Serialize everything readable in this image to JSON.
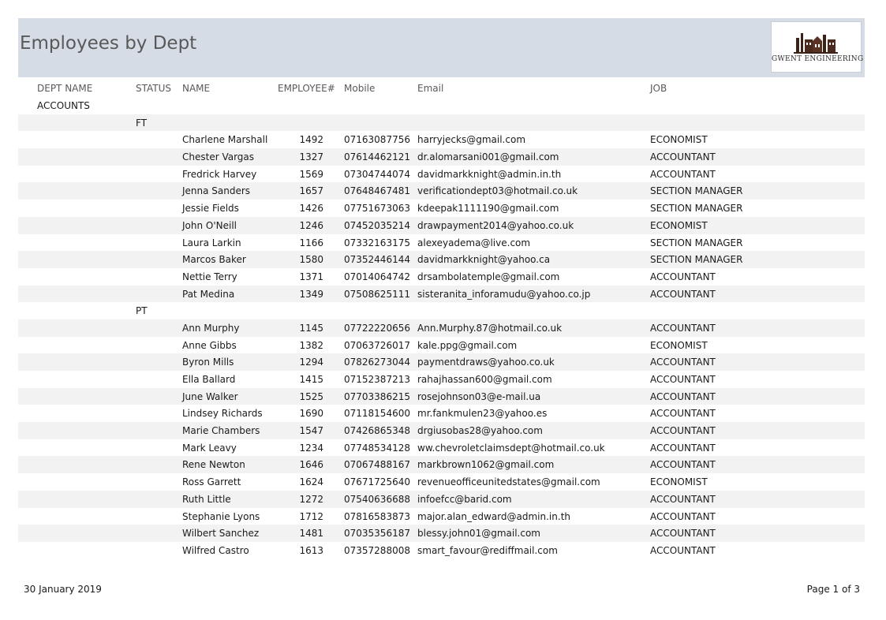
{
  "report": {
    "title": "Employees by Dept",
    "logo_text": "GWENT ENGINEERING"
  },
  "columns": {
    "dept_name": "DEPT NAME",
    "status": "STATUS",
    "name": "NAME",
    "employee_no": "EMPLOYEE#",
    "mobile": "Mobile",
    "email": "Email",
    "job": "JOB"
  },
  "department": "ACCOUNTS",
  "groups": [
    {
      "status": "FT",
      "employees": [
        {
          "name": "Charlene Marshall",
          "id": "1492",
          "mobile": "07163087756",
          "email": "harryjecks@gmail.com",
          "job": "ECONOMIST"
        },
        {
          "name": "Chester Vargas",
          "id": "1327",
          "mobile": "07614462121",
          "email": "dr.alomarsani001@gmail.com",
          "job": "ACCOUNTANT"
        },
        {
          "name": "Fredrick Harvey",
          "id": "1569",
          "mobile": "07304744074",
          "email": "davidmarkknight@admin.in.th",
          "job": "ACCOUNTANT"
        },
        {
          "name": "Jenna Sanders",
          "id": "1657",
          "mobile": "07648467481",
          "email": "verificationdept03@hotmail.co.uk",
          "job": "SECTION MANAGER"
        },
        {
          "name": "Jessie Fields",
          "id": "1426",
          "mobile": "07751673063",
          "email": "kdeepak1111190@gmail.com",
          "job": "SECTION MANAGER"
        },
        {
          "name": "John O'Neill",
          "id": "1246",
          "mobile": "07452035214",
          "email": "drawpayment2014@yahoo.co.uk",
          "job": "ECONOMIST"
        },
        {
          "name": "Laura Larkin",
          "id": "1166",
          "mobile": "07332163175",
          "email": "alexeyadema@live.com",
          "job": "SECTION MANAGER"
        },
        {
          "name": "Marcos Baker",
          "id": "1580",
          "mobile": "07352446144",
          "email": "davidmarkknight@yahoo.ca",
          "job": "SECTION MANAGER"
        },
        {
          "name": "Nettie Terry",
          "id": "1371",
          "mobile": "07014064742",
          "email": "drsambolatemple@gmail.com",
          "job": "ACCOUNTANT"
        },
        {
          "name": "Pat Medina",
          "id": "1349",
          "mobile": "07508625111",
          "email": "sisteranita_inforamudu@yahoo.co.jp",
          "job": "ACCOUNTANT"
        }
      ]
    },
    {
      "status": "PT",
      "employees": [
        {
          "name": "Ann Murphy",
          "id": "1145",
          "mobile": "07722220656",
          "email": "Ann.Murphy.87@hotmail.co.uk",
          "job": "ACCOUNTANT"
        },
        {
          "name": "Anne Gibbs",
          "id": "1382",
          "mobile": "07063726017",
          "email": "kale.ppg@gmail.com",
          "job": "ECONOMIST"
        },
        {
          "name": "Byron Mills",
          "id": "1294",
          "mobile": "07826273044",
          "email": "paymentdraws@yahoo.co.uk",
          "job": "ACCOUNTANT"
        },
        {
          "name": "Ella Ballard",
          "id": "1415",
          "mobile": "07152387213",
          "email": "rahajhassan600@gmail.com",
          "job": "ACCOUNTANT"
        },
        {
          "name": "June Walker",
          "id": "1525",
          "mobile": "07703386215",
          "email": "rosejohnson03@e-mail.ua",
          "job": "ACCOUNTANT"
        },
        {
          "name": "Lindsey Richards",
          "id": "1690",
          "mobile": "07118154600",
          "email": "mr.fankmulen23@yahoo.es",
          "job": "ACCOUNTANT"
        },
        {
          "name": "Marie Chambers",
          "id": "1547",
          "mobile": "07426865348",
          "email": "drgiusobas28@yahoo.com",
          "job": "ACCOUNTANT"
        },
        {
          "name": "Mark Leavy",
          "id": "1234",
          "mobile": "07748534128",
          "email": "ww.chevroletclaimsdept@hotmail.co.uk",
          "job": "ACCOUNTANT"
        },
        {
          "name": "Rene Newton",
          "id": "1646",
          "mobile": "07067488167",
          "email": "markbrown1062@gmail.com",
          "job": "ACCOUNTANT"
        },
        {
          "name": "Ross Garrett",
          "id": "1624",
          "mobile": "07671725640",
          "email": "revenueofficeunitedstates@gmail.com",
          "job": "ECONOMIST"
        },
        {
          "name": "Ruth Little",
          "id": "1272",
          "mobile": "07540636688",
          "email": "infoefcc@barid.com",
          "job": "ACCOUNTANT"
        },
        {
          "name": "Stephanie Lyons",
          "id": "1712",
          "mobile": "07816583873",
          "email": "major.alan_edward@admin.in.th",
          "job": "ACCOUNTANT"
        },
        {
          "name": "Wilbert Sanchez",
          "id": "1481",
          "mobile": "07035356187",
          "email": "blessy.john01@gmail.com",
          "job": "ACCOUNTANT"
        },
        {
          "name": "Wilfred Castro",
          "id": "1613",
          "mobile": "07357288008",
          "email": "smart_favour@rediffmail.com",
          "job": "ACCOUNTANT"
        }
      ]
    }
  ],
  "footer": {
    "date": "30 January 2019",
    "page": "Page 1 of 3"
  },
  "colors": {
    "header_band": "#d5dce6",
    "alt_row": "#f2f2f2",
    "header_text": "#595959"
  }
}
